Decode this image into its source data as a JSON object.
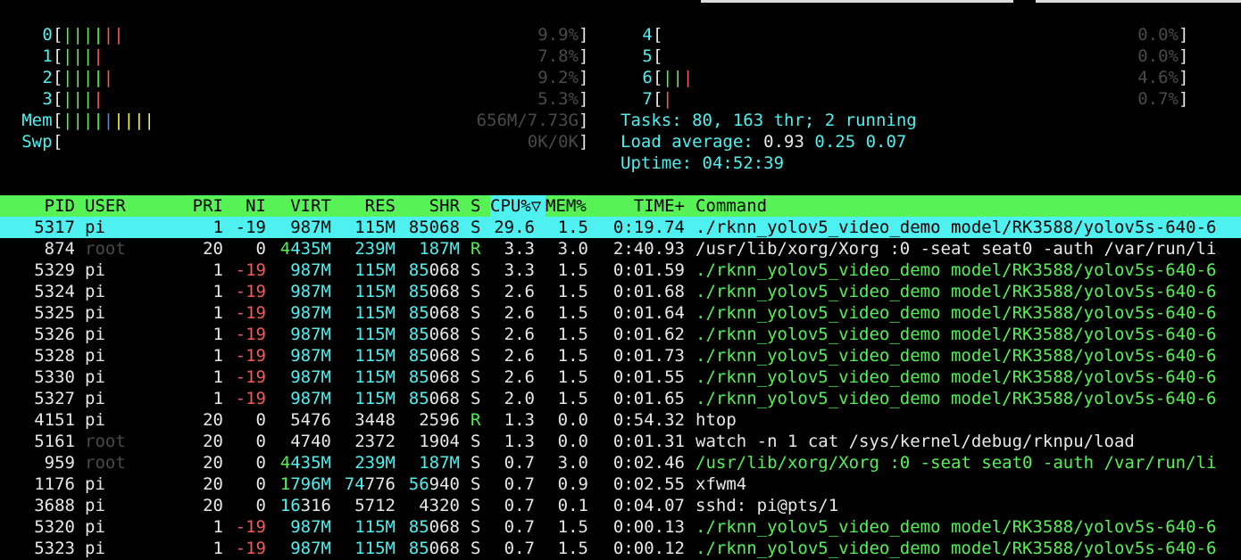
{
  "cpus": [
    {
      "label": "0",
      "bars": [
        {
          "c": "green",
          "n": 4
        },
        {
          "c": "red",
          "n": 2
        }
      ],
      "pct": "9.9%"
    },
    {
      "label": "1",
      "bars": [
        {
          "c": "green",
          "n": 3
        },
        {
          "c": "red",
          "n": 1
        }
      ],
      "pct": "7.8%"
    },
    {
      "label": "2",
      "bars": [
        {
          "c": "green",
          "n": 4
        },
        {
          "c": "red",
          "n": 1
        }
      ],
      "pct": "9.2%"
    },
    {
      "label": "3",
      "bars": [
        {
          "c": "green",
          "n": 3
        },
        {
          "c": "red",
          "n": 1
        }
      ],
      "pct": "5.3%"
    },
    {
      "label": "4",
      "bars": [],
      "pct": "0.0%"
    },
    {
      "label": "5",
      "bars": [],
      "pct": "0.0%"
    },
    {
      "label": "6",
      "bars": [
        {
          "c": "green",
          "n": 2
        },
        {
          "c": "red",
          "n": 1
        }
      ],
      "pct": "4.6%"
    },
    {
      "label": "7",
      "bars": [
        {
          "c": "red",
          "n": 1
        }
      ],
      "pct": "0.7%"
    }
  ],
  "mem": {
    "label": "Mem",
    "bars": [
      {
        "c": "green",
        "n": 4
      },
      {
        "c": "blue",
        "n": 1
      },
      {
        "c": "yellow",
        "n": 4
      }
    ],
    "value": "656M/7.73G"
  },
  "swp": {
    "label": "Swp",
    "value": "0K/0K"
  },
  "tasks": {
    "label": "Tasks: ",
    "value": "80, 163 thr; 2 running"
  },
  "load": {
    "label": "Load average: ",
    "v1": "0.93",
    "v2": "0.25",
    "v3": "0.07"
  },
  "uptime": {
    "label": "Uptime: ",
    "value": "04:52:39"
  },
  "columns": {
    "pid": "PID",
    "user": "USER",
    "pri": "PRI",
    "ni": "NI",
    "virt": "VIRT",
    "res": "RES",
    "shr": "SHR",
    "s": "S",
    "cpu": "CPU%▽",
    "mem": "MEM%",
    "time": "TIME+",
    "cmd": "Command"
  },
  "processes": [
    {
      "pid": "5317",
      "user": "pi",
      "pri": "1",
      "ni": "-19",
      "virt": "987M",
      "res": "115M",
      "shr": "85068",
      "s": "S",
      "cpu": "29.6",
      "mem": "1.5",
      "time": "0:19.74",
      "cmd": "./rknn_yolov5_video_demo model/RK3588/yolov5s-640-6",
      "selected": true
    },
    {
      "pid": "874",
      "user": "root",
      "pri": "20",
      "ni": "0",
      "virt": "4435M",
      "res": "239M",
      "shr": "187M",
      "s": "R",
      "cpu": "3.3",
      "mem": "3.0",
      "time": "2:40.93",
      "cmd": "/usr/lib/xorg/Xorg :0 -seat seat0 -auth /var/run/li",
      "cmdColor": "white"
    },
    {
      "pid": "5329",
      "user": "pi",
      "pri": "1",
      "ni": "-19",
      "virt": "987M",
      "res": "115M",
      "shr": "85068",
      "s": "S",
      "cpu": "3.3",
      "mem": "1.5",
      "time": "0:01.59",
      "cmd": "./rknn_yolov5_video_demo model/RK3588/yolov5s-640-6",
      "cmdColor": "green"
    },
    {
      "pid": "5324",
      "user": "pi",
      "pri": "1",
      "ni": "-19",
      "virt": "987M",
      "res": "115M",
      "shr": "85068",
      "s": "S",
      "cpu": "2.6",
      "mem": "1.5",
      "time": "0:01.68",
      "cmd": "./rknn_yolov5_video_demo model/RK3588/yolov5s-640-6",
      "cmdColor": "green"
    },
    {
      "pid": "5325",
      "user": "pi",
      "pri": "1",
      "ni": "-19",
      "virt": "987M",
      "res": "115M",
      "shr": "85068",
      "s": "S",
      "cpu": "2.6",
      "mem": "1.5",
      "time": "0:01.64",
      "cmd": "./rknn_yolov5_video_demo model/RK3588/yolov5s-640-6",
      "cmdColor": "green"
    },
    {
      "pid": "5326",
      "user": "pi",
      "pri": "1",
      "ni": "-19",
      "virt": "987M",
      "res": "115M",
      "shr": "85068",
      "s": "S",
      "cpu": "2.6",
      "mem": "1.5",
      "time": "0:01.62",
      "cmd": "./rknn_yolov5_video_demo model/RK3588/yolov5s-640-6",
      "cmdColor": "green"
    },
    {
      "pid": "5328",
      "user": "pi",
      "pri": "1",
      "ni": "-19",
      "virt": "987M",
      "res": "115M",
      "shr": "85068",
      "s": "S",
      "cpu": "2.6",
      "mem": "1.5",
      "time": "0:01.73",
      "cmd": "./rknn_yolov5_video_demo model/RK3588/yolov5s-640-6",
      "cmdColor": "green"
    },
    {
      "pid": "5330",
      "user": "pi",
      "pri": "1",
      "ni": "-19",
      "virt": "987M",
      "res": "115M",
      "shr": "85068",
      "s": "S",
      "cpu": "2.6",
      "mem": "1.5",
      "time": "0:01.55",
      "cmd": "./rknn_yolov5_video_demo model/RK3588/yolov5s-640-6",
      "cmdColor": "green"
    },
    {
      "pid": "5327",
      "user": "pi",
      "pri": "1",
      "ni": "-19",
      "virt": "987M",
      "res": "115M",
      "shr": "85068",
      "s": "S",
      "cpu": "2.0",
      "mem": "1.5",
      "time": "0:01.65",
      "cmd": "./rknn_yolov5_video_demo model/RK3588/yolov5s-640-6",
      "cmdColor": "green"
    },
    {
      "pid": "4151",
      "user": "pi",
      "pri": "20",
      "ni": "0",
      "virt": "5476",
      "res": "3448",
      "shr": "2596",
      "s": "R",
      "cpu": "1.3",
      "mem": "0.0",
      "time": "0:54.32",
      "cmd": "htop",
      "cmdColor": "white"
    },
    {
      "pid": "5161",
      "user": "root",
      "pri": "20",
      "ni": "0",
      "virt": "4740",
      "res": "2372",
      "shr": "1904",
      "s": "S",
      "cpu": "1.3",
      "mem": "0.0",
      "time": "0:01.31",
      "cmd": "watch -n 1 cat /sys/kernel/debug/rknpu/load",
      "cmdColor": "white"
    },
    {
      "pid": "959",
      "user": "root",
      "pri": "20",
      "ni": "0",
      "virt": "4435M",
      "res": "239M",
      "shr": "187M",
      "s": "S",
      "cpu": "0.7",
      "mem": "3.0",
      "time": "0:02.46",
      "cmd": "/usr/lib/xorg/Xorg :0 -seat seat0 -auth /var/run/li",
      "cmdColor": "green"
    },
    {
      "pid": "1176",
      "user": "pi",
      "pri": "20",
      "ni": "0",
      "virt": "1796M",
      "res": "74776",
      "shr": "56940",
      "s": "S",
      "cpu": "0.7",
      "mem": "0.9",
      "time": "0:02.55",
      "cmd": "xfwm4",
      "cmdColor": "white"
    },
    {
      "pid": "3688",
      "user": "pi",
      "pri": "20",
      "ni": "0",
      "virt": "16316",
      "res": "5712",
      "shr": "4320",
      "s": "S",
      "cpu": "0.7",
      "mem": "0.1",
      "time": "0:04.07",
      "cmd": "sshd: pi@pts/1",
      "cmdColor": "white"
    },
    {
      "pid": "5320",
      "user": "pi",
      "pri": "1",
      "ni": "-19",
      "virt": "987M",
      "res": "115M",
      "shr": "85068",
      "s": "S",
      "cpu": "0.7",
      "mem": "1.5",
      "time": "0:00.13",
      "cmd": "./rknn_yolov5_video_demo model/RK3588/yolov5s-640-6",
      "cmdColor": "green"
    },
    {
      "pid": "5323",
      "user": "pi",
      "pri": "1",
      "ni": "-19",
      "virt": "987M",
      "res": "115M",
      "shr": "85068",
      "s": "S",
      "cpu": "0.7",
      "mem": "1.5",
      "time": "0:00.12",
      "cmd": "./rknn_yolov5_video_demo model/RK3588/yolov5s-640-6",
      "cmdColor": "green"
    }
  ]
}
